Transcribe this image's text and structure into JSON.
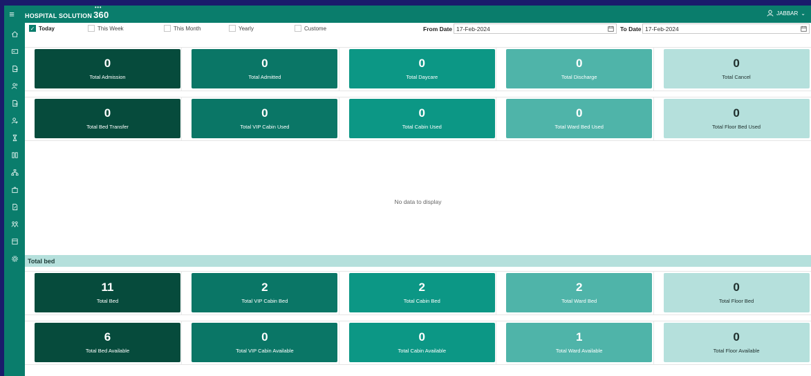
{
  "app": {
    "brand_prefix": "HOSPITAL SOLUTION",
    "brand_number": "360",
    "user": "JABBAR"
  },
  "sidebar": {
    "icons": [
      "home-icon",
      "id-card-icon",
      "document-arrow-icon",
      "users-icon",
      "document-arrow-icon-2",
      "user-add-icon",
      "hourglass-icon",
      "columns-icon",
      "hierarchy-icon",
      "bag-icon",
      "document-edit-icon",
      "people-icon",
      "panel-icon",
      "gear-icon"
    ]
  },
  "filters": {
    "options": [
      {
        "label": "Today",
        "checked": true
      },
      {
        "label": "This Week",
        "checked": false
      },
      {
        "label": "This Month",
        "checked": false
      },
      {
        "label": "Yearly",
        "checked": false
      },
      {
        "label": "Custome",
        "checked": false
      }
    ],
    "from_label": "From Date",
    "from_value": "17-Feb-2024",
    "to_label": "To Date",
    "to_value": "17-Feb-2024"
  },
  "summary_row1": [
    {
      "value": "0",
      "label": "Total Admission"
    },
    {
      "value": "0",
      "label": "Total Admitted"
    },
    {
      "value": "0",
      "label": "Total Daycare"
    },
    {
      "value": "0",
      "label": "Total Discharge"
    },
    {
      "value": "0",
      "label": "Total Cancel"
    }
  ],
  "summary_row2": [
    {
      "value": "0",
      "label": "Total Bed Transfer"
    },
    {
      "value": "0",
      "label": "Total VIP Cabin Used"
    },
    {
      "value": "0",
      "label": "Total Cabin Used"
    },
    {
      "value": "0",
      "label": "Total Ward Bed Used"
    },
    {
      "value": "0",
      "label": "Total Floor Bed Used"
    }
  ],
  "no_data_text": "No data to display",
  "total_bed_section": "Total bed",
  "bed_row1": [
    {
      "value": "11",
      "label": "Total Bed"
    },
    {
      "value": "2",
      "label": "Total VIP Cabin Bed"
    },
    {
      "value": "2",
      "label": "Total Cabin Bed"
    },
    {
      "value": "2",
      "label": "Total Ward Bed"
    },
    {
      "value": "0",
      "label": "Total Floor Bed"
    }
  ],
  "bed_row2": [
    {
      "value": "6",
      "label": "Total Bed Available"
    },
    {
      "value": "0",
      "label": "Total VIP Cabin Available"
    },
    {
      "value": "0",
      "label": "Total Cabin Available"
    },
    {
      "value": "1",
      "label": "Total Ward Available"
    },
    {
      "value": "0",
      "label": "Total Floor Available"
    }
  ],
  "colors": {
    "primary": "#0a7d6c",
    "card1": "#064b3c",
    "card2": "#0a7666",
    "card3": "#0c9785",
    "card4": "#4fb4a9",
    "card5": "#b5e0dc"
  }
}
